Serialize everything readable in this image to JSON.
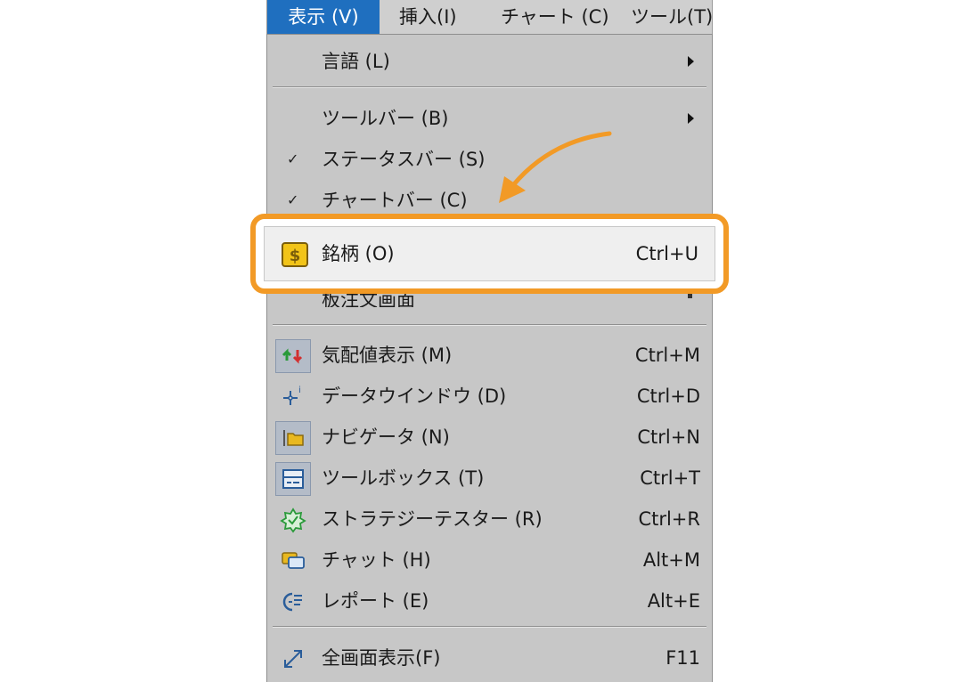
{
  "menubar": {
    "items": [
      {
        "label": "表示 (V)"
      },
      {
        "label": "挿入(I)"
      },
      {
        "label": "チャート (C)"
      },
      {
        "label": "ツール(T)"
      }
    ]
  },
  "menu": {
    "language": {
      "label": "言語 (L)"
    },
    "toolbar": {
      "label": "ツールバー (B)"
    },
    "statusbar": {
      "label": "ステータスバー (S)",
      "checked": true
    },
    "chartbar": {
      "label": "チャートバー (C)",
      "checked": true
    },
    "symbols": {
      "label": "銘柄 (O)",
      "shortcut": "Ctrl+U",
      "icon": "dollar-icon"
    },
    "hidden_item": {
      "label": "板注文画面"
    },
    "market_watch": {
      "label": "気配値表示 (M)",
      "shortcut": "Ctrl+M",
      "icon": "market-watch-icon"
    },
    "data_window": {
      "label": "データウインドウ (D)",
      "shortcut": "Ctrl+D",
      "icon": "crosshair-icon"
    },
    "navigator": {
      "label": "ナビゲータ (N)",
      "shortcut": "Ctrl+N",
      "icon": "folder-icon"
    },
    "toolbox": {
      "label": "ツールボックス (T)",
      "shortcut": "Ctrl+T",
      "icon": "toolbox-icon"
    },
    "strategy_tester": {
      "label": "ストラテジーテスター (R)",
      "shortcut": "Ctrl+R",
      "icon": "gear-icon"
    },
    "chat": {
      "label": "チャット (H)",
      "shortcut": "Alt+M",
      "icon": "chat-icon"
    },
    "report": {
      "label": "レポート (E)",
      "shortcut": "Alt+E",
      "icon": "report-icon"
    },
    "fullscreen": {
      "label": "全画面表示(F)",
      "shortcut": "F11",
      "icon": "expand-icon"
    }
  },
  "colors": {
    "highlight": "#f29a26",
    "menu_bg": "#c7c7c7",
    "active_menu": "#1f6fbf"
  }
}
